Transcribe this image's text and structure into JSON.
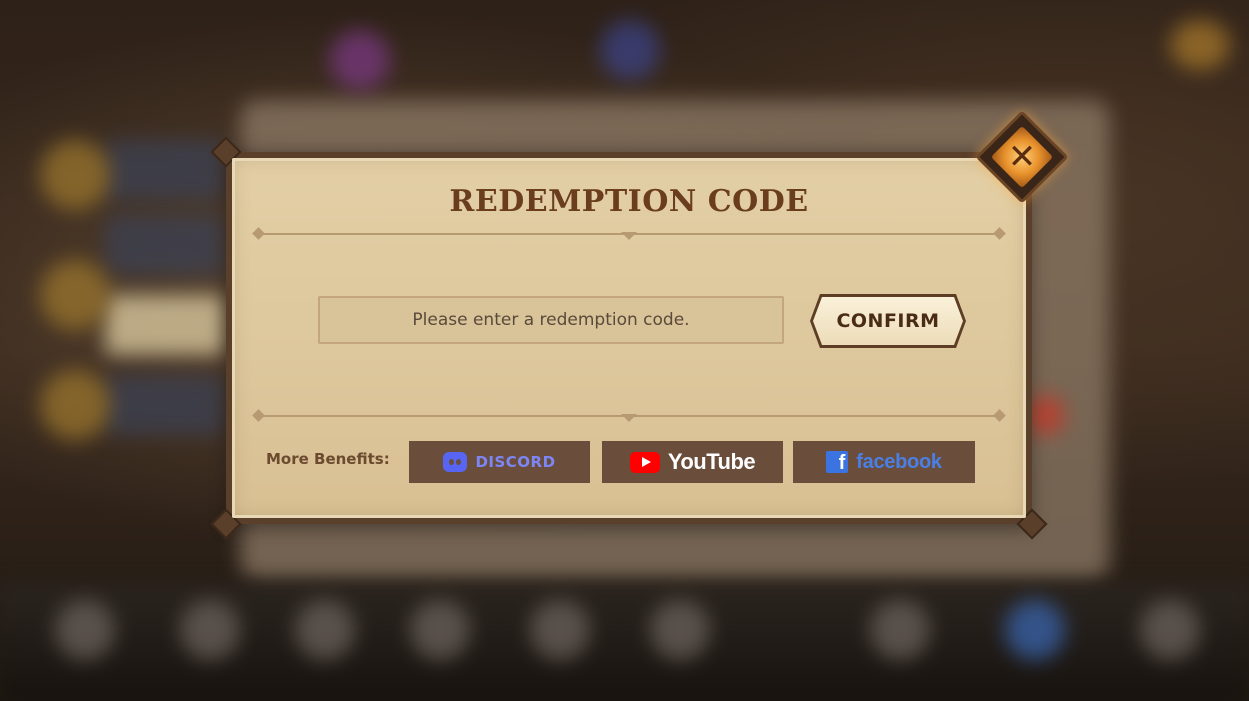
{
  "dialog": {
    "title": "REDEMPTION CODE",
    "input_placeholder": "Please enter a redemption code.",
    "input_value": "",
    "confirm_label": "CONFIRM",
    "benefits_label": "More Benefits:"
  },
  "social": {
    "discord": {
      "label": "DISCORD",
      "icon": "discord-icon",
      "color": "#5865f2"
    },
    "youtube": {
      "label": "YouTube",
      "icon": "youtube-icon",
      "color": "#ff0000"
    },
    "facebook": {
      "label": "facebook",
      "icon": "facebook-icon",
      "color": "#3b74e0"
    }
  },
  "colors": {
    "frame": "#5a3f2b",
    "parchment": "#e3cfa6",
    "title": "#6b3d1f",
    "social_button_bg": "#6a4e3b",
    "close_glow": "#e8922c"
  }
}
